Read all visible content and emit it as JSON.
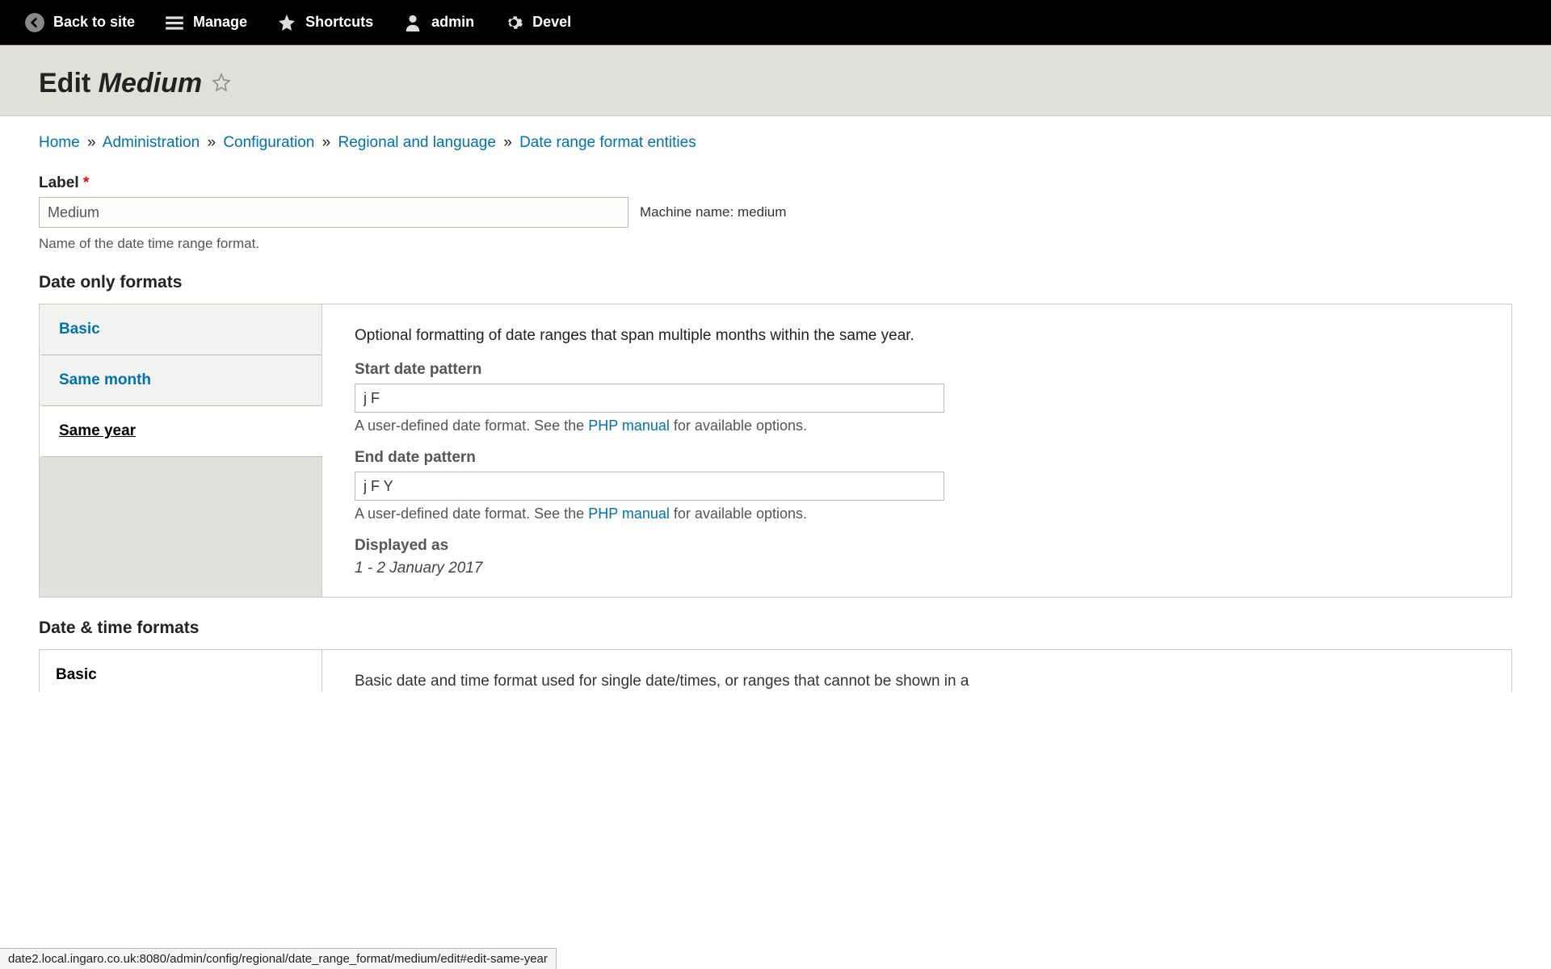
{
  "toolbar": {
    "back": "Back to site",
    "manage": "Manage",
    "shortcuts": "Shortcuts",
    "user": "admin",
    "devel": "Devel"
  },
  "page": {
    "title_prefix": "Edit",
    "title_em": "Medium"
  },
  "breadcrumb": {
    "items": [
      "Home",
      "Administration",
      "Configuration",
      "Regional and language",
      "Date range format entities"
    ],
    "sep": "»"
  },
  "label_field": {
    "label": "Label",
    "value": "Medium",
    "machine_name": "Machine name: medium",
    "description": "Name of the date time range format."
  },
  "section1": {
    "title": "Date only formats",
    "tabs": [
      "Basic",
      "Same month",
      "Same year"
    ],
    "content": {
      "desc": "Optional formatting of date ranges that span multiple months within the same year.",
      "start_label": "Start date pattern",
      "start_value": "j F",
      "start_help_pre": "A user-defined date format. See the ",
      "php_link": "PHP manual",
      "start_help_post": " for available options.",
      "end_label": "End date pattern",
      "end_value": "j F Y",
      "end_help_pre": "A user-defined date format. See the ",
      "end_help_post": " for available options.",
      "displayed_label": "Displayed as",
      "displayed_value": "1 - 2 January 2017"
    }
  },
  "section2": {
    "title": "Date & time formats",
    "tab": "Basic",
    "desc": "Basic date and time format used for single date/times, or ranges that cannot be shown in a"
  },
  "status_url": "date2.local.ingaro.co.uk:8080/admin/config/regional/date_range_format/medium/edit#edit-same-year"
}
